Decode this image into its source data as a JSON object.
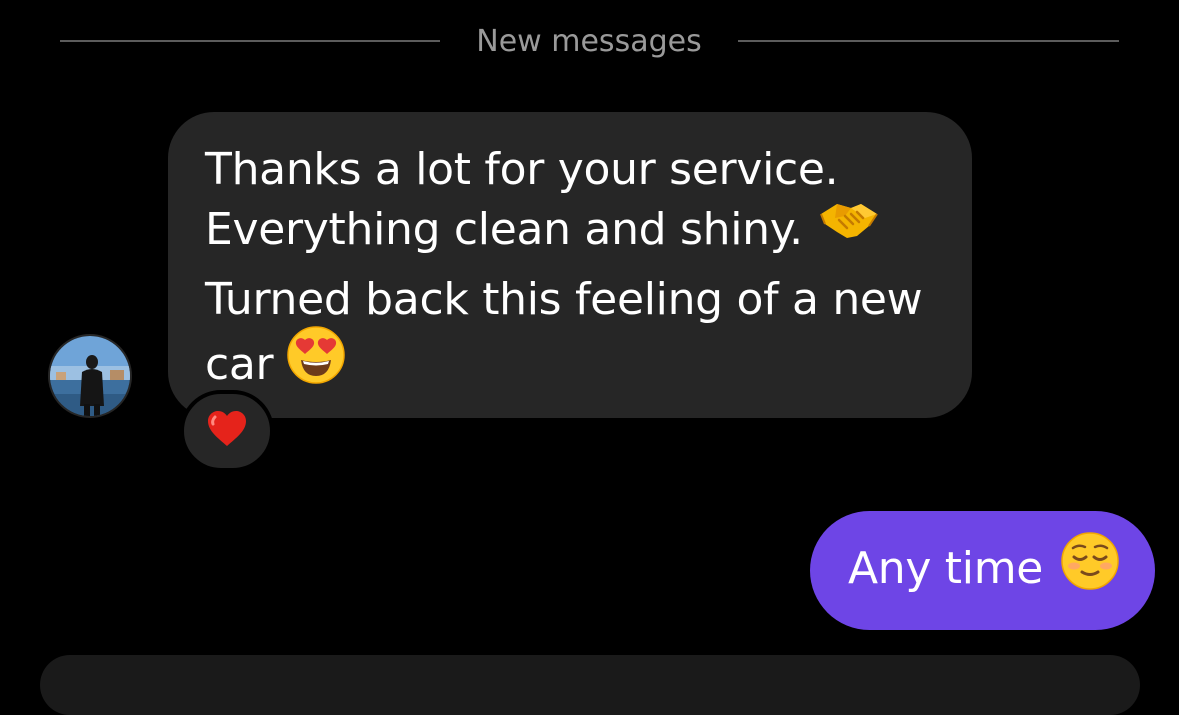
{
  "divider": {
    "label": "New messages"
  },
  "incoming_message": {
    "line1": "Thanks a lot for your service.",
    "line2": "Everything clean and shiny.",
    "line2_emoji": "handshake-emoji",
    "line3": "Turned back this feeling of a new",
    "line4": "car",
    "line4_emoji": "heart-eyes-emoji",
    "reaction": "red-heart-emoji",
    "sender_avatar": "avatar-photo"
  },
  "outgoing_message": {
    "text": "Any time",
    "emoji": "relieved-face-emoji"
  },
  "colors": {
    "background": "#000000",
    "incoming_bubble": "#262626",
    "outgoing_bubble": "#6e45e6",
    "divider_text": "#9a9a9a",
    "divider_line": "#5c5c5c"
  }
}
